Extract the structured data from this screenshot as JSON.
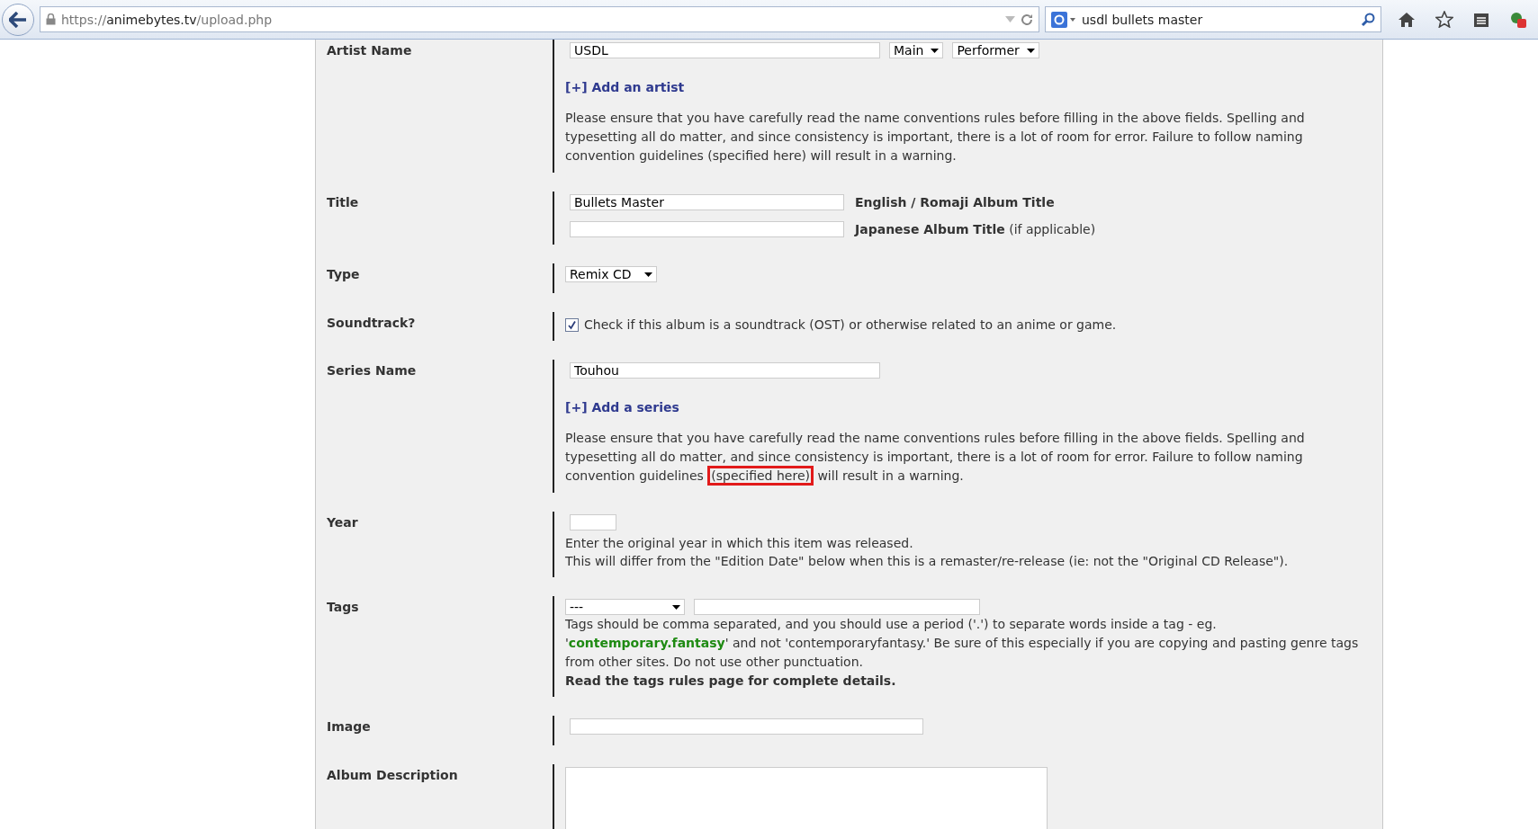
{
  "browser": {
    "url": {
      "scheme": "https://",
      "host": "animebytes.tv",
      "path": "/upload.php"
    },
    "search": {
      "value": "usdl bullets master"
    }
  },
  "rows": [
    {
      "kind": "artist",
      "label": "Artist Name",
      "value": "USDL",
      "selects": [
        "Main",
        "Performer"
      ],
      "add_link": "[+] Add an artist",
      "notice": {
        "before": "Please ensure that you have carefully read the name conventions rules before filling in the above fields. Spelling and typesetting all do matter, and since consistency is important, there is a lot of room for error. Failure to follow naming convention guidelines ",
        "link": "(specified here)",
        "after": " will result in a warning.",
        "highlighted": false
      }
    },
    {
      "kind": "title",
      "label": "Title",
      "lines": [
        {
          "value": "Bullets Master",
          "caption": "English / Romaji Album Title"
        },
        {
          "caption": "Japanese Album Title",
          "note": "(if applicable)"
        }
      ]
    },
    {
      "kind": "type",
      "label": "Type",
      "selects": [
        "Remix CD"
      ]
    },
    {
      "kind": "soundtrack",
      "label": "Soundtrack?",
      "checked": true,
      "text": "Check if this album is a soundtrack (OST) or otherwise related to an anime or game."
    },
    {
      "kind": "series",
      "label": "Series Name",
      "value": "Touhou",
      "add_link": "[+] Add a series",
      "notice": {
        "before": "Please ensure that you have carefully read the name conventions rules before filling in the above fields. Spelling and typesetting all do matter, and since consistency is important, there is a lot of room for error. Failure to follow naming convention guidelines ",
        "link": "(specified here)",
        "after": " will result in a warning.",
        "highlighted": true
      }
    },
    {
      "kind": "year",
      "label": "Year",
      "texts": [
        "Enter the original year in which this item was released.",
        "This will differ from the \"Edition Date\" below when this is a remaster/re-release (ie: not the \"Original CD Release\")."
      ]
    },
    {
      "kind": "tags",
      "label": "Tags",
      "selects": [
        "---"
      ],
      "help": {
        "before": "Tags should be comma separated, and you should use a period ('.') to separate words inside a tag - eg. '",
        "example": "contemporary.fantasy",
        "after": "' and not 'contemporaryfantasy.' Be sure of this especially if you are copying and pasting genre tags from other sites. Do not use other punctuation."
      },
      "rules": "Read the tags rules page for complete details."
    },
    {
      "kind": "image",
      "label": "Image"
    },
    {
      "kind": "description",
      "label": "Album Description"
    }
  ]
}
